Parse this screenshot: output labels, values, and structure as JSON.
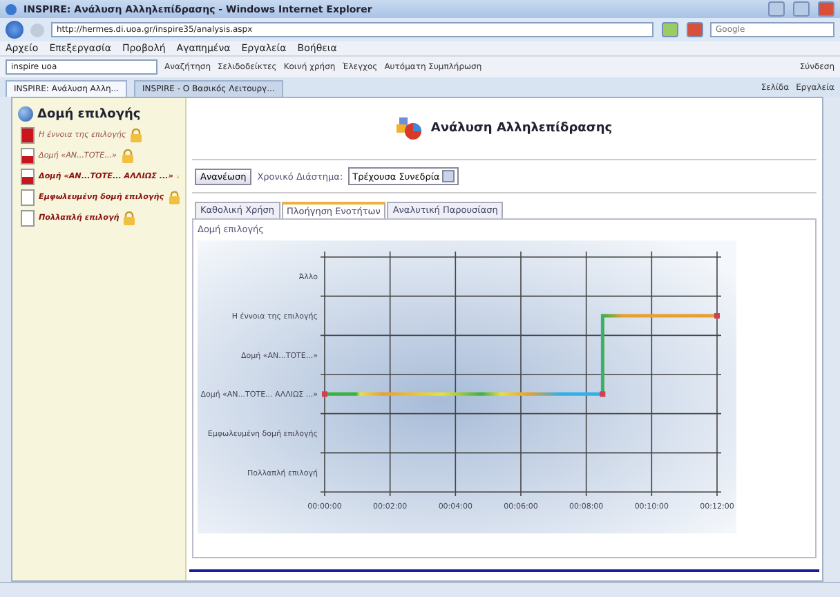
{
  "window": {
    "title": "INSPIRE: Ανάλυση Αλληλεπίδρασης - Windows Internet Explorer"
  },
  "address_bar": {
    "url": "http://hermes.di.uoa.gr/inspire35/analysis.aspx",
    "placeholder": "Google"
  },
  "menu": [
    "Αρχείο",
    "Επεξεργασία",
    "Προβολή",
    "Αγαπημένα",
    "Εργαλεία",
    "Βοήθεια"
  ],
  "google_toolbar": {
    "query": "inspire uoa",
    "buttons": [
      "Αναζήτηση",
      "Σελιδοδείκτες",
      "Κοινή χρήση",
      "Έλεγχος",
      "Αυτόματη Συμπλήρωση"
    ],
    "sign_in": "Σύνδεση"
  },
  "browser_tabs": [
    {
      "label": "INSPIRE: Ανάλυση Αλλη...",
      "selected": true
    },
    {
      "label": "INSPIRE - Ο Βασικός Λειτουργ...",
      "selected": false
    }
  ],
  "command_bar": [
    "Σελίδα",
    "Εργαλεία"
  ],
  "sidebar": {
    "title": "Δομή επιλογής",
    "items": [
      {
        "label": "Η έννοια της επιλογής",
        "level": 1,
        "emphasized": false
      },
      {
        "label": "Δομή «ΑΝ...ΤΟΤΕ...»",
        "level": 0.5,
        "emphasized": false
      },
      {
        "label": "Δομή «ΑΝ...ΤΟΤΕ... ΑΛΛΙΩΣ ...»",
        "level": 0.5,
        "emphasized": true
      },
      {
        "label": "Εμφωλευμένη δομή επιλογής",
        "level": 0,
        "emphasized": true
      },
      {
        "label": "Πολλαπλή επιλογή",
        "level": 0,
        "emphasized": true
      }
    ]
  },
  "main": {
    "title": "Ανάλυση Αλληλεπίδρασης",
    "refresh_button": "Ανανέωση",
    "period_label": "Χρονικό Διάστημα:",
    "period_select": "Τρέχουσα Συνεδρία",
    "tabs": [
      {
        "label": "Καθολική Χρήση",
        "selected": false
      },
      {
        "label": "Πλοήγηση Ενοτήτων",
        "selected": true
      },
      {
        "label": "Αναλυτική Παρουσίαση",
        "selected": false
      }
    ],
    "panel_title": "Δομή επιλογής",
    "timeline": {
      "row_labels": [
        "Άλλο",
        "Η έννοια της επιλογής",
        "Δομή «ΑΝ...ΤΟΤΕ...»",
        "Δομή «ΑΝ...ΤΟΤΕ... ΑΛΛΙΩΣ ...»",
        "Εμφωλευμένη δομή επιλογής",
        "Πολλαπλή επιλογή"
      ],
      "time_labels": [
        "00:00:00",
        "00:02:00",
        "00:04:00",
        "00:06:00",
        "00:08:00",
        "00:10:00",
        "00:12:00"
      ]
    }
  }
}
